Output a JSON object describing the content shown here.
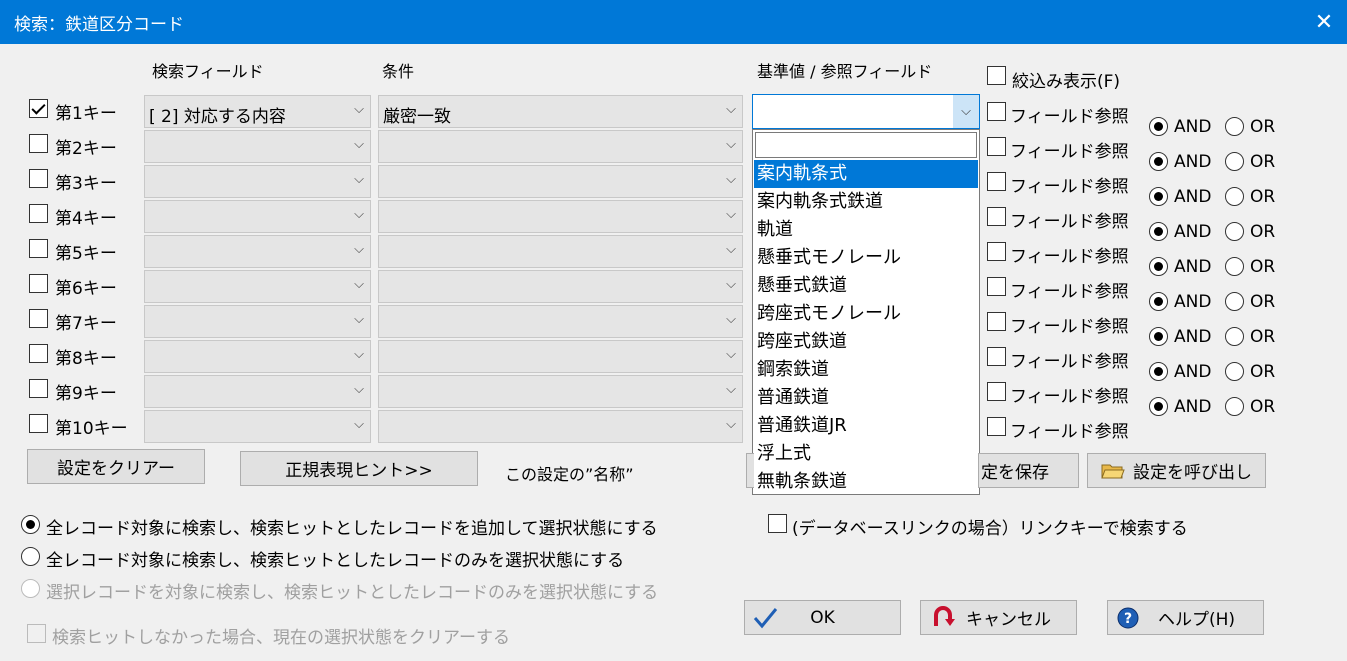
{
  "window": {
    "title": "検索：鉄道区分コード",
    "close_glyph": "✕"
  },
  "headers": {
    "field": "検索フィールド",
    "condition": "条件",
    "reference": "基準値 / 参照フィールド"
  },
  "narrow_display": {
    "label": "絞込み表示(F)",
    "checked": false
  },
  "keys": [
    {
      "label": "第1キー",
      "checked": true,
      "field": "[ 2] 対応する内容",
      "condition": "厳密一致"
    },
    {
      "label": "第2キー",
      "checked": false,
      "field": "",
      "condition": ""
    },
    {
      "label": "第3キー",
      "checked": false,
      "field": "",
      "condition": ""
    },
    {
      "label": "第4キー",
      "checked": false,
      "field": "",
      "condition": ""
    },
    {
      "label": "第5キー",
      "checked": false,
      "field": "",
      "condition": ""
    },
    {
      "label": "第6キー",
      "checked": false,
      "field": "",
      "condition": ""
    },
    {
      "label": "第7キー",
      "checked": false,
      "field": "",
      "condition": ""
    },
    {
      "label": "第8キー",
      "checked": false,
      "field": "",
      "condition": ""
    },
    {
      "label": "第9キー",
      "checked": false,
      "field": "",
      "condition": ""
    },
    {
      "label": "第10キー",
      "checked": false,
      "field": "",
      "condition": ""
    }
  ],
  "field_ref_label": "フィールド参照",
  "and_label": "AND",
  "or_label": "OR",
  "dropdown": {
    "value": "",
    "options": [
      "案内軌条式",
      "案内軌条式鉄道",
      "軌道",
      "懸垂式モノレール",
      "懸垂式鉄道",
      "跨座式モノレール",
      "跨座式鉄道",
      "鋼索鉄道",
      "普通鉄道",
      "普通鉄道JR",
      "浮上式",
      "無軌条鉄道"
    ],
    "selected_index": 0
  },
  "buttons": {
    "clear": "設定をクリアー",
    "regex_hint": "正規表現ヒント>>",
    "save": "定を保存",
    "load": "設定を呼び出し",
    "ok": "OK",
    "cancel": "キャンセル",
    "help": "ヘルプ(H)"
  },
  "setting_name_label": "この設定の”名称”",
  "db_link_label": "(データベースリンクの場合）リンクキーで検索する",
  "options": [
    {
      "label": "全レコード対象に検索し、検索ヒットとしたレコードを追加して選択状態にする",
      "selected": true,
      "disabled": false
    },
    {
      "label": "全レコード対象に検索し、検索ヒットとしたレコードのみを選択状態にする",
      "selected": false,
      "disabled": false
    },
    {
      "label": "選択レコードを対象に検索し、検索ヒットとしたレコードのみを選択状態にする",
      "selected": false,
      "disabled": true
    }
  ],
  "clear_when_no_hit": "検索ヒットしなかった場合、現在の選択状態をクリアーする",
  "colors": {
    "titlebar": "#0078d7",
    "selection": "#0078d7",
    "background": "#f0f0f0"
  }
}
